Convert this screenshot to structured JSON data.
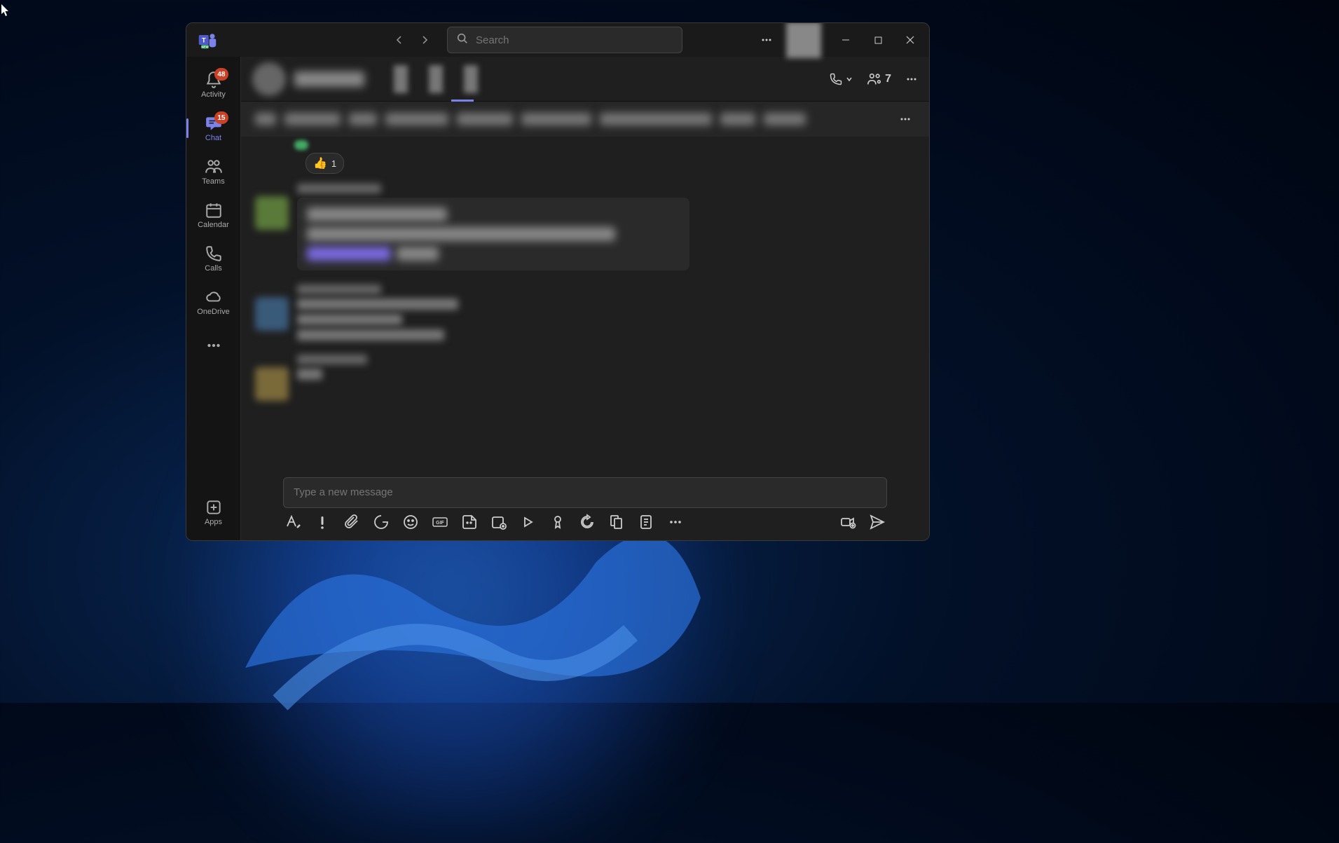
{
  "search": {
    "placeholder": "Search"
  },
  "rail": {
    "activity": {
      "label": "Activity",
      "badge": "48"
    },
    "chat": {
      "label": "Chat",
      "badge": "15"
    },
    "teams": {
      "label": "Teams"
    },
    "calendar": {
      "label": "Calendar"
    },
    "calls": {
      "label": "Calls"
    },
    "onedrive": {
      "label": "OneDrive"
    },
    "apps": {
      "label": "Apps"
    }
  },
  "header": {
    "participants": "7"
  },
  "reaction": {
    "emoji": "👍",
    "count": "1"
  },
  "compose": {
    "placeholder": "Type a new message"
  }
}
